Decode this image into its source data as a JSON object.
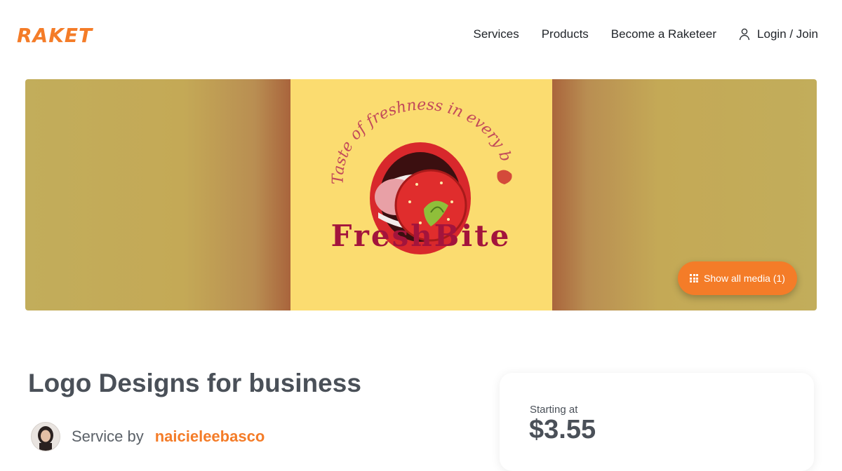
{
  "header": {
    "logo": "RAKET",
    "nav": {
      "services": "Services",
      "products": "Products",
      "become": "Become a Raketeer",
      "login": "Login / Join"
    }
  },
  "hero": {
    "art_tagline": "Taste of freshness in every bite",
    "art_brand": "FreshBite",
    "media_button": "Show all media (1)"
  },
  "service": {
    "title": "Logo Designs for business",
    "by_label": "Service by",
    "username": "naicieleebasco"
  },
  "pricing": {
    "label": "Starting at",
    "price": "$3.55"
  },
  "colors": {
    "accent": "#f47c28",
    "text": "#4a5058",
    "art_bg": "#fbdc70"
  }
}
